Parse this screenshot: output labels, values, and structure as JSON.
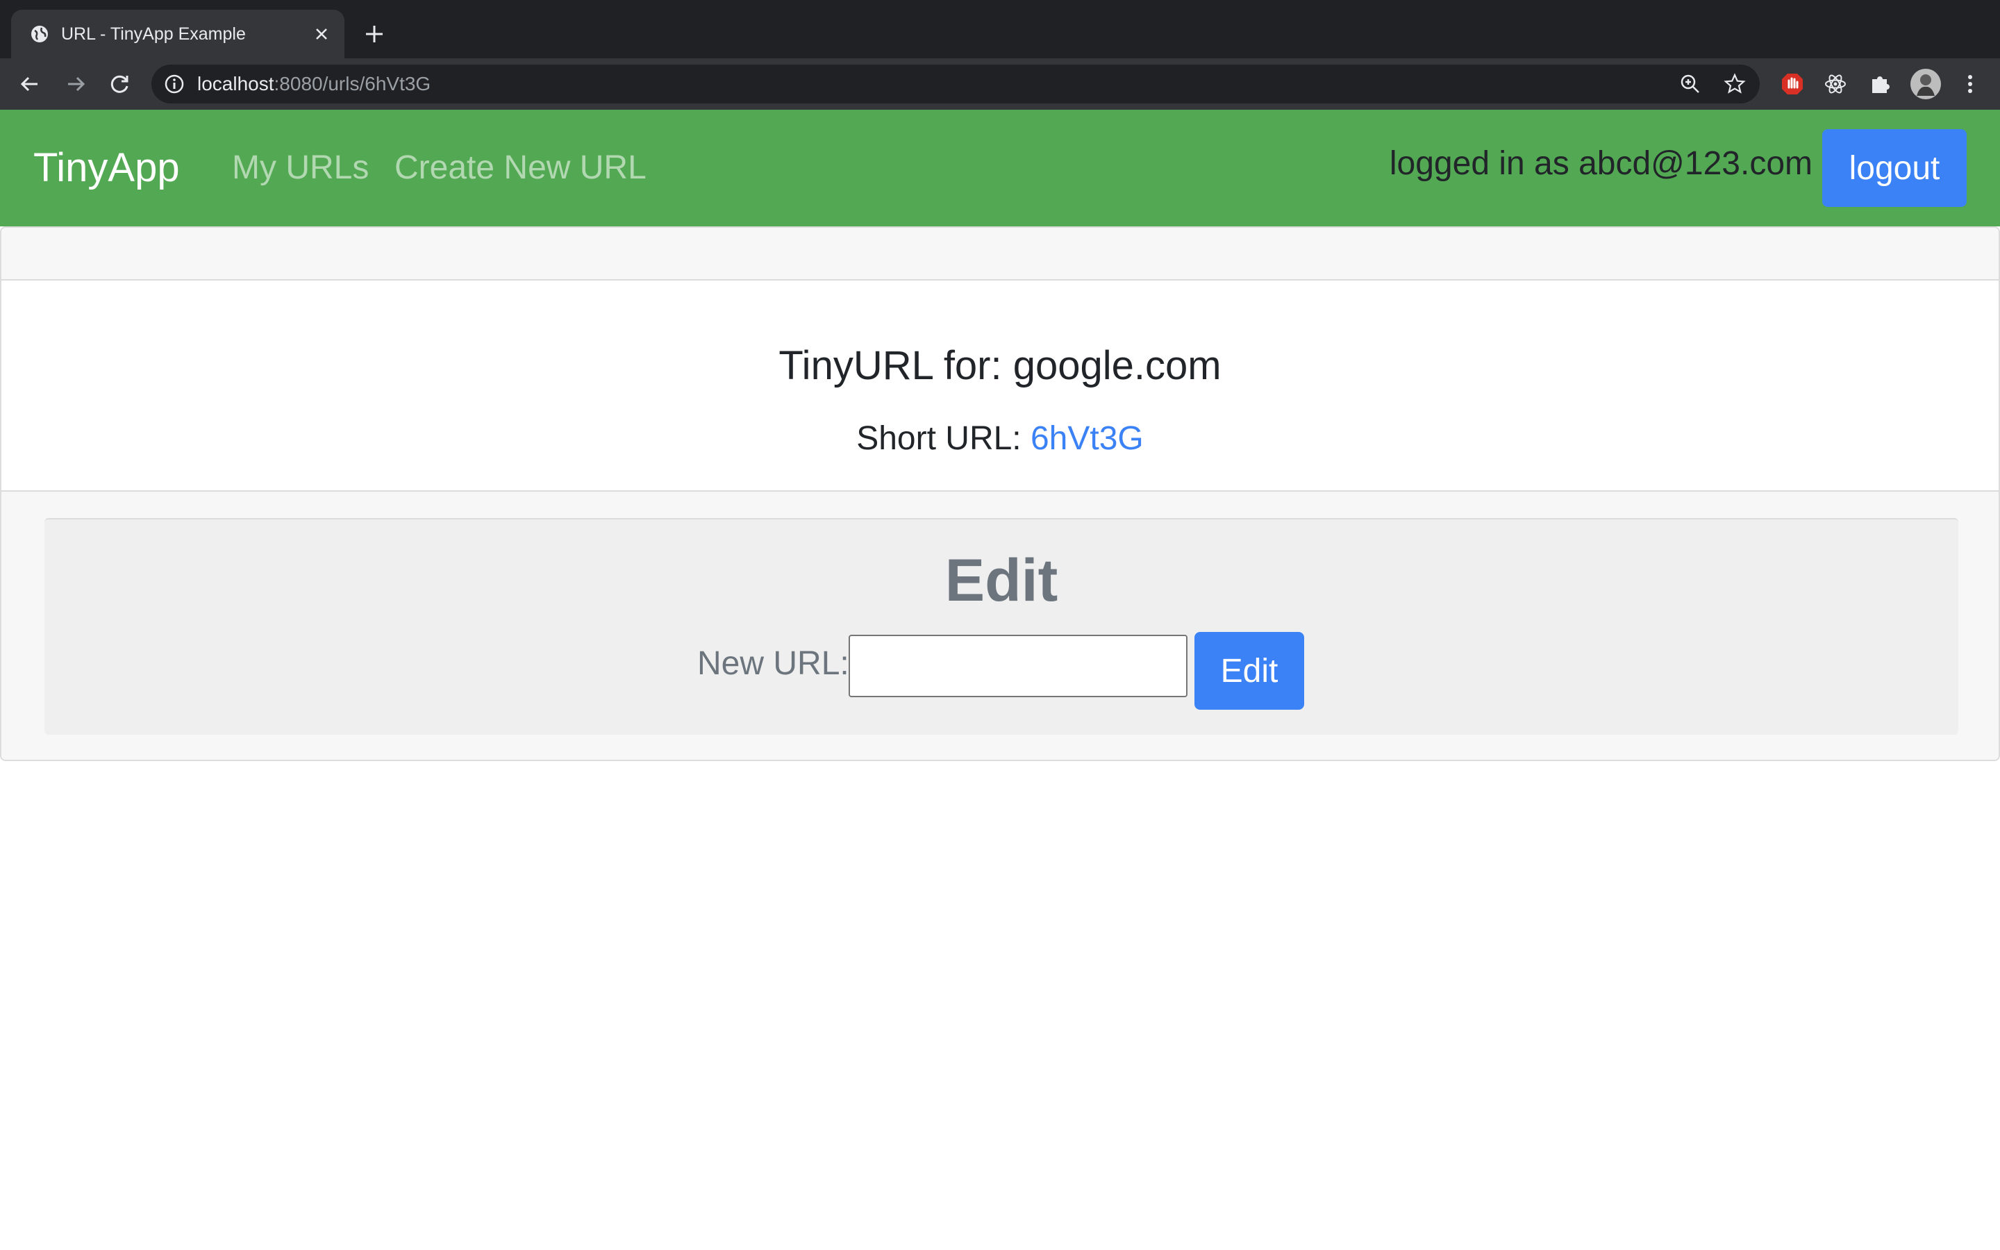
{
  "browser": {
    "tab_title": "URL - TinyApp Example",
    "url_host": "localhost",
    "url_path": ":8080/urls/6hVt3G"
  },
  "navbar": {
    "brand": "TinyApp",
    "links": [
      "My URLs",
      "Create New URL"
    ],
    "login_status": "logged in as abcd@123.com",
    "logout_label": "logout",
    "bg_color": "#53a853"
  },
  "url_card": {
    "title": "TinyURL for: google.com",
    "short_url_label": "Short URL: ",
    "short_url_value": "6hVt3G"
  },
  "edit_form": {
    "heading": "Edit",
    "new_url_label": "New URL:",
    "input_value": "",
    "button_label": "Edit"
  },
  "colors": {
    "accent": "#3b82f6",
    "text": "#212529",
    "muted": "#6c757d"
  }
}
